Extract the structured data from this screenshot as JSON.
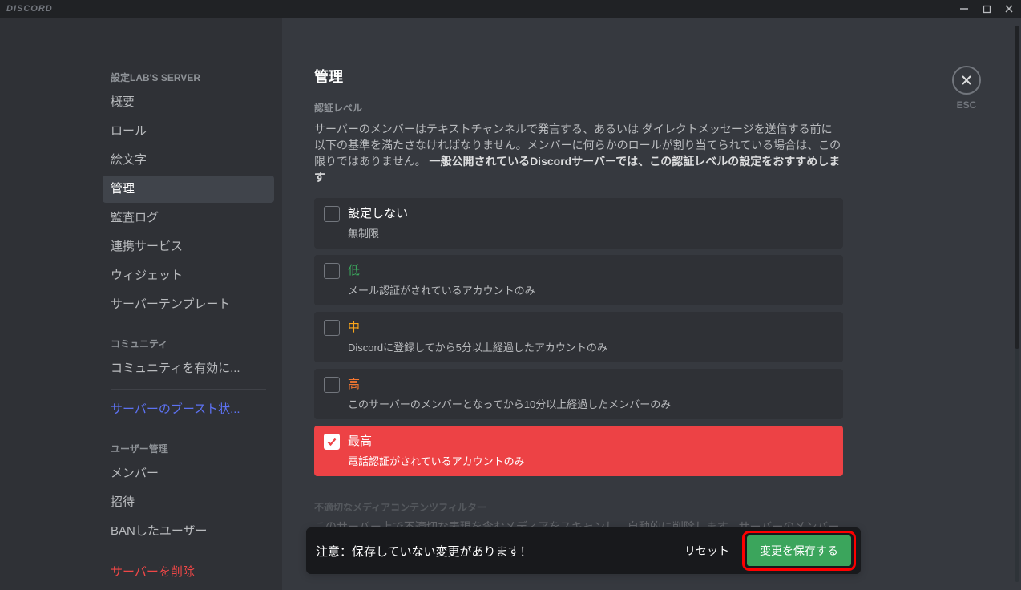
{
  "app": {
    "logo": "DISCORD"
  },
  "sidebar": {
    "header1": "設定LAB'S SERVER",
    "items1": [
      "概要",
      "ロール",
      "絵文字",
      "管理",
      "監査ログ",
      "連携サービス",
      "ウィジェット",
      "サーバーテンプレート"
    ],
    "active_index": 3,
    "header2": "コミュニティ",
    "items2": [
      "コミュニティを有効に..."
    ],
    "boost": "サーバーのブースト状...",
    "header3": "ユーザー管理",
    "items3": [
      "メンバー",
      "招待",
      "BANしたユーザー"
    ],
    "delete": "サーバーを削除"
  },
  "content": {
    "title": "管理",
    "section_label": "認証レベル",
    "desc_part1": "サーバーのメンバーはテキストチャンネルで発言する、あるいは ダイレクトメッセージを送信する前に以下の基準を満たさなければなりません。メンバーに何らかのロールが割り当てられている場合は、この限りではありません。 ",
    "desc_bold": "一般公開されているDiscordサーバーでは、この認証レベルの設定をおすすめします",
    "options": [
      {
        "title": "設定しない",
        "desc": "無制限",
        "cls": "c-none",
        "selected": false
      },
      {
        "title": "低",
        "desc": "メール認証がされているアカウントのみ",
        "cls": "c-low",
        "selected": false
      },
      {
        "title": "中",
        "desc": "Discordに登録してから5分以上経過したアカウントのみ",
        "cls": "c-medium",
        "selected": false
      },
      {
        "title": "高",
        "desc": "このサーバーのメンバーとなってから10分以上経過したメンバーのみ",
        "cls": "c-high",
        "selected": false
      },
      {
        "title": "最高",
        "desc": "電話認証がされているアカウントのみ",
        "cls": "c-highest",
        "selected": true
      }
    ],
    "faded": {
      "title": "不適切なメディアコンテンツフィルター",
      "desc": "このサーバー上で不適切な表現を含むメディアをスキャンし、自動的に削除します。サーバーのメンバー"
    }
  },
  "close": {
    "label": "ESC"
  },
  "savebar": {
    "message": "注意：保存していない変更があります！",
    "reset": "リセット",
    "save": "変更を保存する"
  }
}
